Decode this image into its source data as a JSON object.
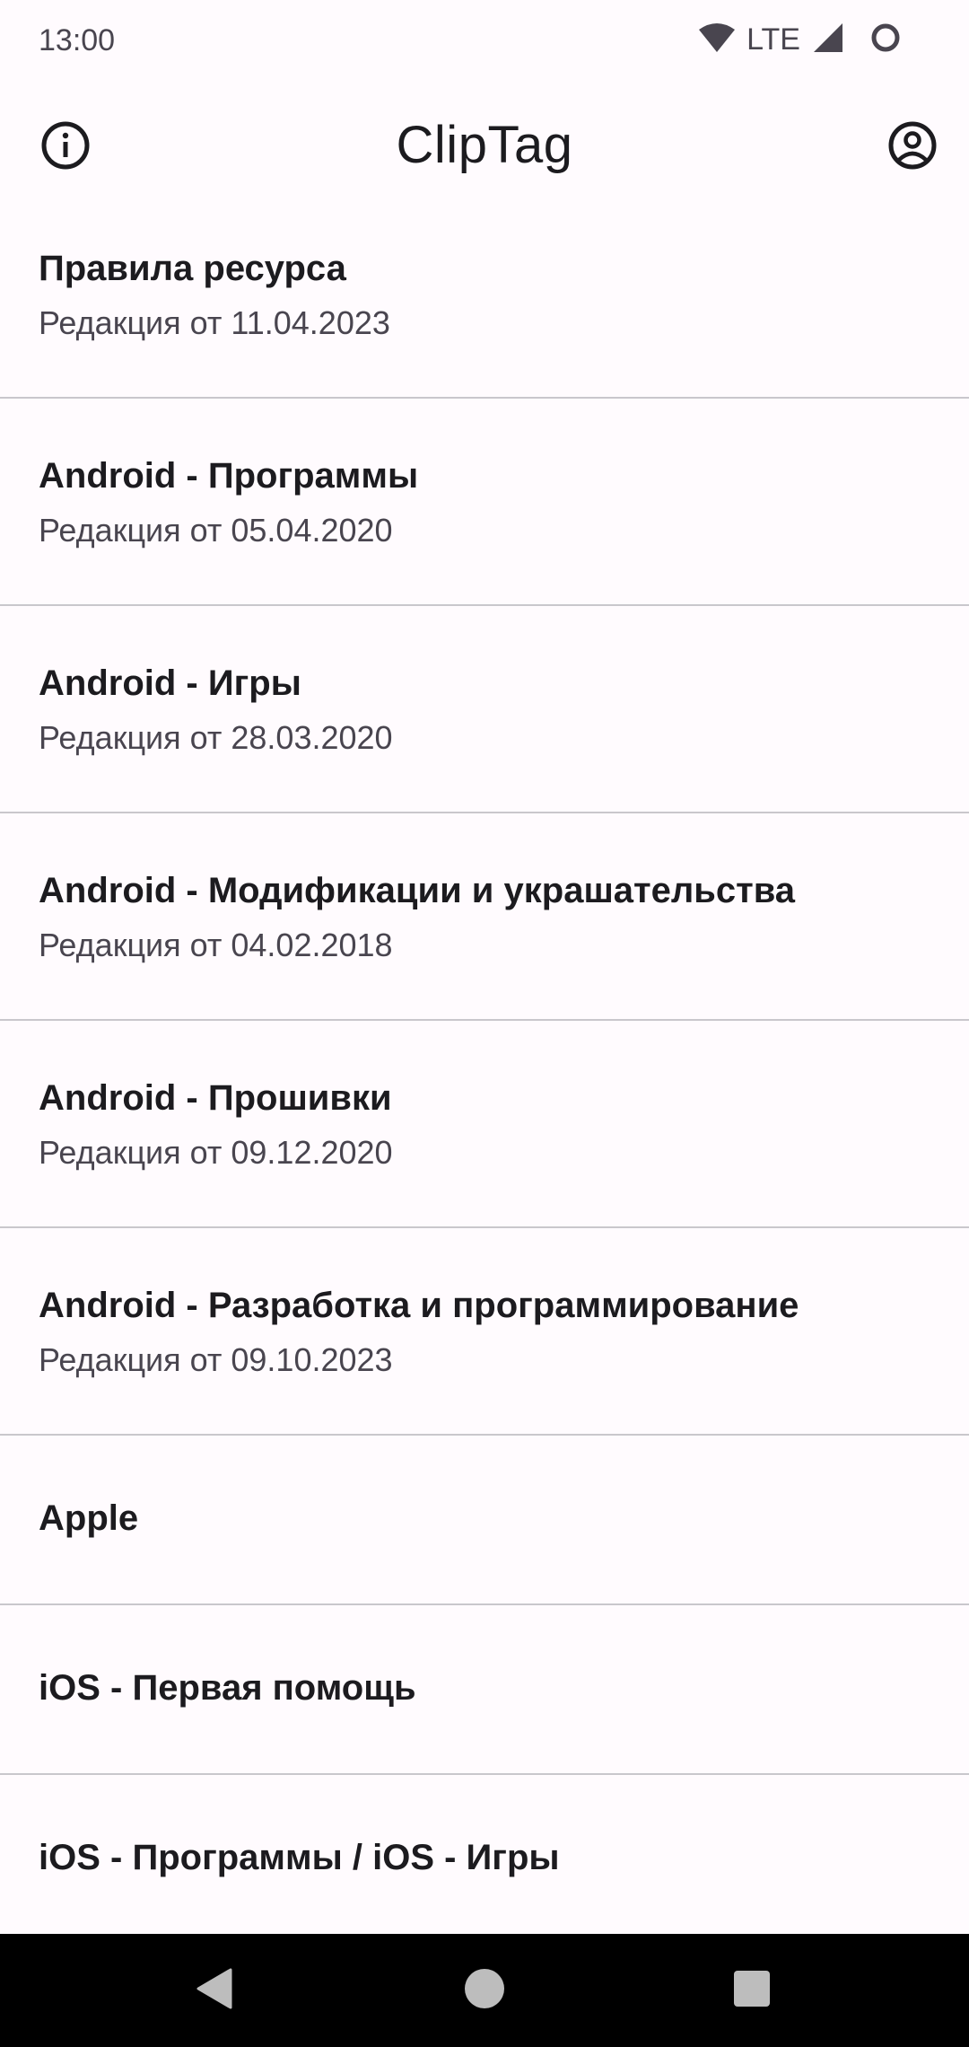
{
  "status_bar": {
    "time": "13:00",
    "network": "LTE",
    "icons": [
      "wifi-icon",
      "cell-signal-icon",
      "battery-icon"
    ]
  },
  "app_bar": {
    "title": "ClipTag",
    "left_icon": "info-icon",
    "right_icon": "account-icon"
  },
  "list": {
    "items": [
      {
        "title": "Правила ресурса",
        "subtitle": "Редакция от 11.04.2023"
      },
      {
        "title": "Android - Программы",
        "subtitle": "Редакция от 05.04.2020"
      },
      {
        "title": "Android - Игры",
        "subtitle": "Редакция от 28.03.2020"
      },
      {
        "title": "Android - Модификации и украшательства",
        "subtitle": "Редакция от 04.02.2018"
      },
      {
        "title": "Android - Прошивки",
        "subtitle": "Редакция от 09.12.2020"
      },
      {
        "title": "Android - Разработка и программирование",
        "subtitle": "Редакция от 09.10.2023"
      },
      {
        "title": "Apple"
      },
      {
        "title": "iOS - Первая помощь"
      },
      {
        "title": "iOS - Программы / iOS - Игры"
      }
    ]
  },
  "nav_bar": {
    "icons": [
      "back-icon",
      "home-icon",
      "recents-icon"
    ]
  },
  "colors": {
    "background": "#fffbfe",
    "text_primary": "#1c1b1f",
    "text_secondary": "#49454f",
    "divider": "#c9c7cc",
    "nav_bar": "#000000"
  }
}
